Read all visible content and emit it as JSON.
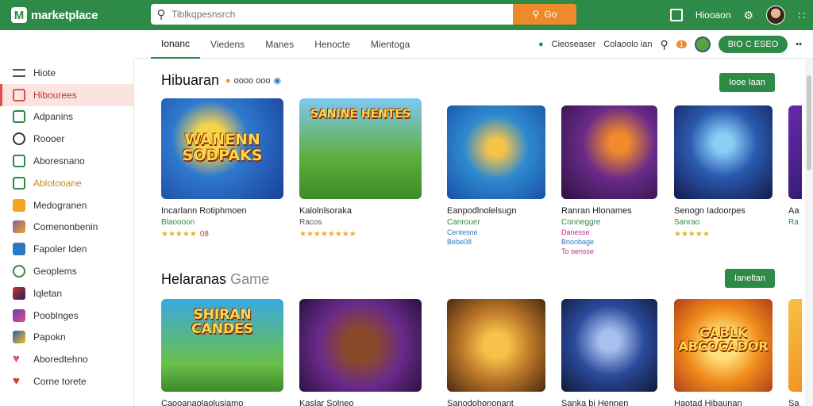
{
  "header": {
    "logo_text": "marketplace",
    "search_placeholder": "Tiblkqpesnsrch",
    "search_button_label": "Go",
    "account_label": "Hiooaon"
  },
  "nav": {
    "tabs": [
      {
        "label": "Ionanc"
      },
      {
        "label": "Viedens"
      },
      {
        "label": "Manes"
      },
      {
        "label": "Henocte"
      },
      {
        "label": "Mientoga"
      }
    ],
    "right_label_1": "Cieoseaser",
    "right_label_2": "Colaoolo ian",
    "badge_count": "1",
    "wallet_label": "BIO  C  ESEO"
  },
  "sidebar": {
    "items": [
      {
        "label": "Hiote",
        "color": "#555555"
      },
      {
        "label": "Hibourees",
        "color": "#d9534f"
      },
      {
        "label": "Adpanins",
        "color": "#2e8b47"
      },
      {
        "label": "Roooer",
        "color": "#333333"
      },
      {
        "label": "Aboresnano",
        "color": "#2e8b47"
      },
      {
        "label": "Ablotooane",
        "color": "#c98a1a"
      },
      {
        "label": "Medogranen",
        "color": "#f2a51e"
      },
      {
        "label": "Comenonbenin",
        "color": "#7b5ea7"
      },
      {
        "label": "Fapoler Iden",
        "color": "#2a7ac0"
      },
      {
        "label": "Geoplems",
        "color": "#2e8b47"
      },
      {
        "label": "Iqletan",
        "color": "#c0392b"
      },
      {
        "label": "Pooblnges",
        "color": "#6a3fa0"
      },
      {
        "label": "Papokn",
        "color": "#2a5ab0"
      },
      {
        "label": "Aboredtehno",
        "color": "#e24ca0"
      },
      {
        "label": "Corne torete",
        "color": "#d63a2a"
      }
    ]
  },
  "section1": {
    "title": "Hibuaran",
    "badge_text": "oooo  ooo",
    "see_all": "Iooe Iaan",
    "cards": [
      {
        "art": "WANENN SODPAKS",
        "title": "Incarlann Rotiphmoen",
        "sub": "Blaoooon",
        "stars": "★★★★★",
        "rating": "08"
      },
      {
        "art": "SANINE HENTES",
        "title": "Kalolnlsoraka",
        "sub": "Racos",
        "stars": "★★★★★★★★",
        "rating": ""
      },
      {
        "art": "",
        "title": "Eanpodlnolelsugn",
        "sub": "Canrouer",
        "sub2": "Centesne",
        "sub3": "Bebe08",
        "stars": "",
        "rating": ""
      },
      {
        "art": "",
        "title": "Ranran Hlonames",
        "sub": "Conneggre",
        "sub2": "Danesse",
        "sub3": "Bnonbage",
        "sub4": "To oensse",
        "stars": "",
        "rating": ""
      },
      {
        "art": "",
        "title": "Senogn Iadoorpes",
        "sub": "Sanrao",
        "stars": "★★★★★",
        "rating": ""
      },
      {
        "art": "",
        "title": "Aa",
        "sub": "Ra",
        "stars": "",
        "rating": ""
      }
    ]
  },
  "section2": {
    "title_bold": "Helaranas",
    "title_light": "Game",
    "see_all": "Ianeltan",
    "cards": [
      {
        "art": "SHIRAN CANDES",
        "title": "Caooanaolaolusiamo"
      },
      {
        "art": "",
        "title": "Kaslar Solneo"
      },
      {
        "art": "",
        "title": "Sanodohononant"
      },
      {
        "art": "",
        "title": "Sanka bi Hennen"
      },
      {
        "art": "GABLK ABCOCADOR",
        "title": "Haotad Hibaunan"
      },
      {
        "art": "",
        "title": "Sa"
      }
    ]
  }
}
